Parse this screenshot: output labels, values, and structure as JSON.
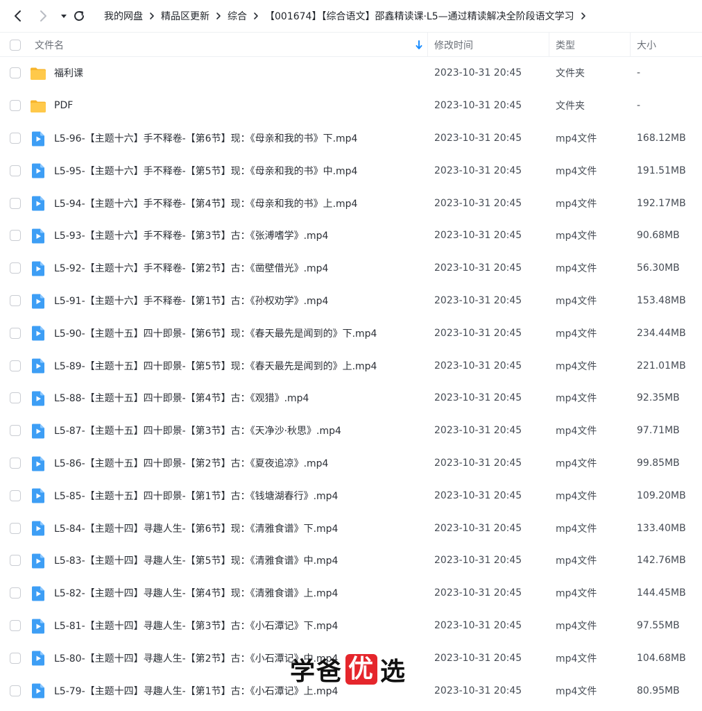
{
  "nav": {
    "back_icon": "chevron-left-icon",
    "forward_icon": "chevron-right-icon",
    "dropdown_icon": "caret-down-icon",
    "refresh_icon": "refresh-icon"
  },
  "breadcrumb": [
    {
      "label": "我的网盘"
    },
    {
      "label": "精品区更新"
    },
    {
      "label": "综合"
    },
    {
      "label": "【001674】【综合语文】邵鑫精读课·L5—通过精读解决全阶段语文学习"
    }
  ],
  "columns": {
    "name": "文件名",
    "modified": "修改时间",
    "type": "类型",
    "size": "大小",
    "sort_icon": "sort-down-arrow-icon"
  },
  "colors": {
    "folder": "#ffc53d",
    "video": "#3d9ef5",
    "sort_accent": "#1a8cff",
    "watermark_highlight": "#e5262c"
  },
  "files": [
    {
      "name": "福利课",
      "modified": "2023-10-31 20:45",
      "type": "文件夹",
      "size": "-",
      "icon": "folder-icon"
    },
    {
      "name": "PDF",
      "modified": "2023-10-31 20:45",
      "type": "文件夹",
      "size": "-",
      "icon": "folder-icon"
    },
    {
      "name": "L5-96-【主题十六】手不释卷-【第6节】现：《母亲和我的书》下.mp4",
      "modified": "2023-10-31 20:45",
      "type": "mp4文件",
      "size": "168.12MB",
      "icon": "video-file-icon"
    },
    {
      "name": "L5-95-【主题十六】手不释卷-【第5节】现：《母亲和我的书》中.mp4",
      "modified": "2023-10-31 20:45",
      "type": "mp4文件",
      "size": "191.51MB",
      "icon": "video-file-icon"
    },
    {
      "name": "L5-94-【主题十六】手不释卷-【第4节】现：《母亲和我的书》上.mp4",
      "modified": "2023-10-31 20:45",
      "type": "mp4文件",
      "size": "192.17MB",
      "icon": "video-file-icon"
    },
    {
      "name": "L5-93-【主题十六】手不释卷-【第3节】古：《张溥嗜学》.mp4",
      "modified": "2023-10-31 20:45",
      "type": "mp4文件",
      "size": "90.68MB",
      "icon": "video-file-icon"
    },
    {
      "name": "L5-92-【主题十六】手不释卷-【第2节】古：《凿壁借光》.mp4",
      "modified": "2023-10-31 20:45",
      "type": "mp4文件",
      "size": "56.30MB",
      "icon": "video-file-icon"
    },
    {
      "name": "L5-91-【主题十六】手不释卷-【第1节】古：《孙权劝学》.mp4",
      "modified": "2023-10-31 20:45",
      "type": "mp4文件",
      "size": "153.48MB",
      "icon": "video-file-icon"
    },
    {
      "name": "L5-90-【主题十五】四十即景-【第6节】现：《春天最先是闻到的》下.mp4",
      "modified": "2023-10-31 20:45",
      "type": "mp4文件",
      "size": "234.44MB",
      "icon": "video-file-icon"
    },
    {
      "name": "L5-89-【主题十五】四十即景-【第5节】现：《春天最先是闻到的》上.mp4",
      "modified": "2023-10-31 20:45",
      "type": "mp4文件",
      "size": "221.01MB",
      "icon": "video-file-icon"
    },
    {
      "name": "L5-88-【主题十五】四十即景-【第4节】古：《观猎》.mp4",
      "modified": "2023-10-31 20:45",
      "type": "mp4文件",
      "size": "92.35MB",
      "icon": "video-file-icon"
    },
    {
      "name": "L5-87-【主题十五】四十即景-【第3节】古：《天净沙·秋思》.mp4",
      "modified": "2023-10-31 20:45",
      "type": "mp4文件",
      "size": "97.71MB",
      "icon": "video-file-icon"
    },
    {
      "name": "L5-86-【主题十五】四十即景-【第2节】古：《夏夜追凉》.mp4",
      "modified": "2023-10-31 20:45",
      "type": "mp4文件",
      "size": "99.85MB",
      "icon": "video-file-icon"
    },
    {
      "name": "L5-85-【主题十五】四十即景-【第1节】古：《钱塘湖春行》.mp4",
      "modified": "2023-10-31 20:45",
      "type": "mp4文件",
      "size": "109.20MB",
      "icon": "video-file-icon"
    },
    {
      "name": "L5-84-【主题十四】寻趣人生-【第6节】现：《清雅食谱》下.mp4",
      "modified": "2023-10-31 20:45",
      "type": "mp4文件",
      "size": "133.40MB",
      "icon": "video-file-icon"
    },
    {
      "name": "L5-83-【主题十四】寻趣人生-【第5节】现：《清雅食谱》中.mp4",
      "modified": "2023-10-31 20:45",
      "type": "mp4文件",
      "size": "142.76MB",
      "icon": "video-file-icon"
    },
    {
      "name": "L5-82-【主题十四】寻趣人生-【第4节】现：《清雅食谱》上.mp4",
      "modified": "2023-10-31 20:45",
      "type": "mp4文件",
      "size": "144.45MB",
      "icon": "video-file-icon"
    },
    {
      "name": "L5-81-【主题十四】寻趣人生-【第3节】古：《小石潭记》下.mp4",
      "modified": "2023-10-31 20:45",
      "type": "mp4文件",
      "size": "97.55MB",
      "icon": "video-file-icon"
    },
    {
      "name": "L5-80-【主题十四】寻趣人生-【第2节】古：《小石潭记》中.mp4",
      "modified": "2023-10-31 20:45",
      "type": "mp4文件",
      "size": "104.68MB",
      "icon": "video-file-icon"
    },
    {
      "name": "L5-79-【主题十四】寻趣人生-【第1节】古：《小石潭记》上.mp4",
      "modified": "2023-10-31 20:45",
      "type": "mp4文件",
      "size": "80.95MB",
      "icon": "video-file-icon"
    }
  ],
  "watermark": {
    "part1": "学爸",
    "highlight": "优",
    "part2": "选"
  }
}
